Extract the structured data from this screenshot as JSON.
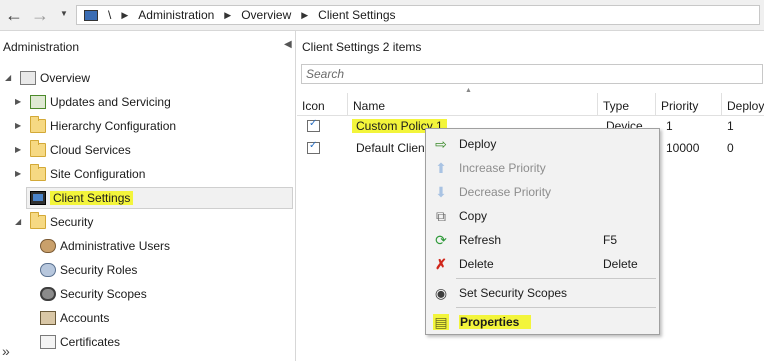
{
  "address_bar": {
    "back_icon": "arrow-left",
    "forward_icon": "arrow-right",
    "root_sep": "\\",
    "crumbs": [
      "Administration",
      "Overview",
      "Client Settings"
    ]
  },
  "nav": {
    "title": "Administration",
    "items": [
      {
        "label": "Overview",
        "icon": "overview-icon"
      },
      {
        "label": "Updates and Servicing",
        "icon": "updates-icon"
      },
      {
        "label": "Hierarchy Configuration",
        "icon": "folder-icon"
      },
      {
        "label": "Cloud Services",
        "icon": "folder-icon"
      },
      {
        "label": "Site Configuration",
        "icon": "folder-icon"
      },
      {
        "label": "Client Settings",
        "icon": "client-settings-icon"
      },
      {
        "label": "Security",
        "icon": "folder-icon"
      },
      {
        "label": "Administrative Users",
        "icon": "users-icon"
      },
      {
        "label": "Security Roles",
        "icon": "roles-icon"
      },
      {
        "label": "Security Scopes",
        "icon": "lock-icon"
      },
      {
        "label": "Accounts",
        "icon": "accounts-icon"
      },
      {
        "label": "Certificates",
        "icon": "certificate-icon"
      }
    ],
    "expand_chevron": "»"
  },
  "content": {
    "title": "Client Settings 2 items",
    "search_placeholder": "Search",
    "columns": [
      "Icon",
      "Name",
      "Type",
      "Priority",
      "Deploym"
    ],
    "rows": [
      {
        "name": "Custom Policy 1",
        "type": "Device",
        "priority": "1",
        "deployments": "1"
      },
      {
        "name": "Default Client",
        "type": "",
        "priority": "10000",
        "deployments": "0"
      }
    ]
  },
  "context_menu": {
    "items": [
      {
        "label": "Deploy",
        "key": "",
        "enabled": true,
        "icon": "deploy-icon"
      },
      {
        "label": "Increase Priority",
        "key": "",
        "enabled": false,
        "icon": "arrow-up-icon"
      },
      {
        "label": "Decrease Priority",
        "key": "",
        "enabled": false,
        "icon": "arrow-down-icon"
      },
      {
        "label": "Copy",
        "key": "",
        "enabled": true,
        "icon": "copy-icon"
      },
      {
        "label": "Refresh",
        "key": "F5",
        "enabled": true,
        "icon": "refresh-icon"
      },
      {
        "label": "Delete",
        "key": "Delete",
        "enabled": true,
        "icon": "delete-icon"
      },
      {
        "label": "Set Security Scopes",
        "key": "",
        "enabled": true,
        "icon": "lock-icon"
      },
      {
        "label": "Properties",
        "key": "",
        "enabled": true,
        "icon": "properties-icon"
      }
    ]
  },
  "colors": {
    "highlight": "#f3f53b",
    "selection_bg": "#f1f1f1"
  }
}
